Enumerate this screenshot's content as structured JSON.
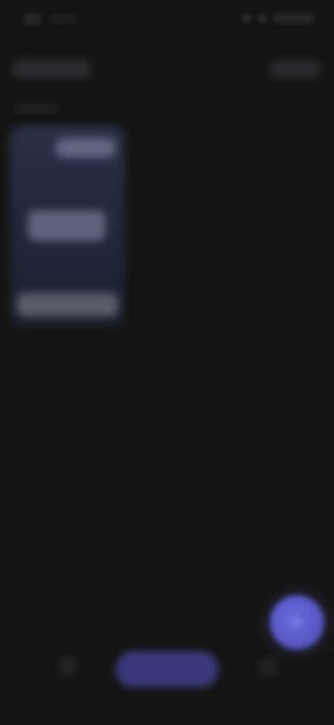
{
  "status_bar": {
    "left_icons": [
      "signal-icon",
      "wifi-icon"
    ],
    "right_icons": [
      "battery-icon"
    ]
  },
  "header": {
    "title": "",
    "action_label": ""
  },
  "main": {
    "section_label": "",
    "card": {
      "top_chip": "",
      "center_text": "",
      "bottom_text": ""
    }
  },
  "fab": {
    "icon": "plus-icon"
  },
  "bottom_nav": {
    "items": [
      {
        "icon": "home-icon"
      },
      {
        "label": ""
      },
      {
        "icon": "profile-icon"
      }
    ]
  },
  "colors": {
    "background": "#141412",
    "card_top": "#2a3146",
    "card_bottom": "#1b1f2b",
    "accent": "#5a59c8",
    "nav_active": "#3f3e88"
  }
}
